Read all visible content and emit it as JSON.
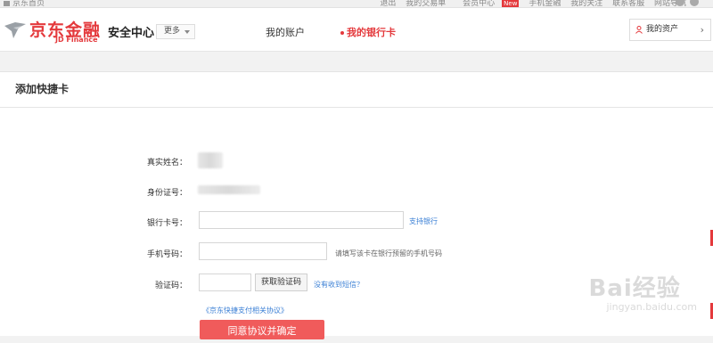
{
  "topbar": {
    "home_label": "京东首页",
    "links": [
      "退出",
      "我的交易单",
      "会员中心",
      "手机金融",
      "我的关注",
      "联系客服",
      "网站导航"
    ],
    "badge": "New"
  },
  "header": {
    "logo_text": "京东金融",
    "logo_sub": "JD Finance",
    "site_title": "安全中心",
    "more_label": "更多",
    "nav": [
      {
        "label": "我的账户"
      },
      {
        "label": "我的银行卡"
      }
    ],
    "assets_label": "我的资产"
  },
  "card": {
    "title": "添加快捷卡"
  },
  "form": {
    "name_label": "真实姓名：",
    "id_label": "身份证号：",
    "card_label": "银行卡号：",
    "card_value": "",
    "supported_banks_link": "支持银行",
    "phone_label": "手机号码：",
    "phone_value": "",
    "phone_hint": "请填写该卡在银行预留的手机号码",
    "code_label": "验证码：",
    "code_value": "",
    "get_code_button": "获取验证码",
    "no_sms_link": "没有收到短信？",
    "agreement_link": "《京东快捷支付相关协议》",
    "submit_button": "同意协议并确定"
  },
  "watermark": {
    "main": "Bai经验",
    "sub": "jingyan.baidu.com"
  },
  "colors": {
    "brand_red": "#e4393c",
    "button_red": "#f05b5b",
    "link_blue": "#3a7fd5"
  }
}
